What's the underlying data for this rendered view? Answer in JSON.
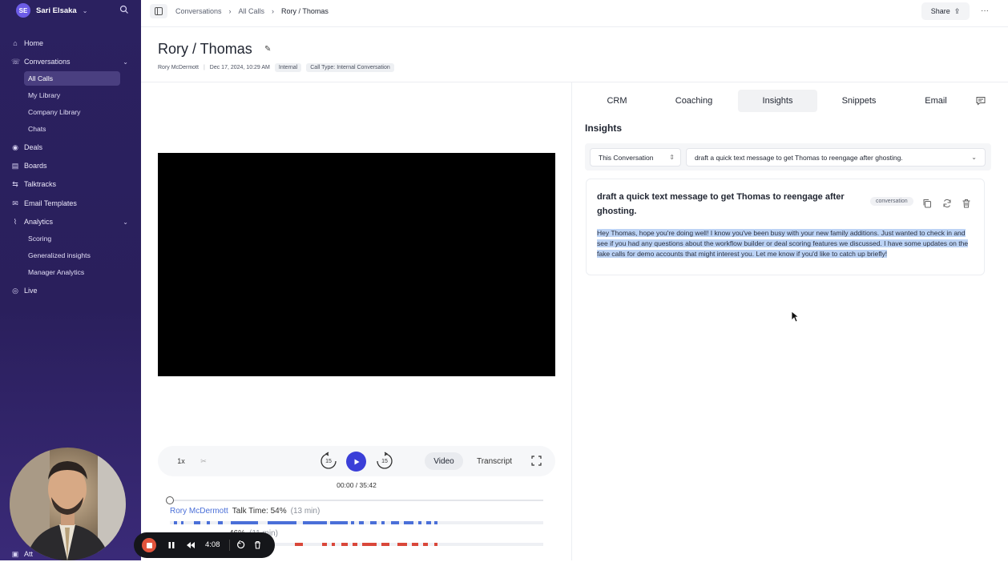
{
  "workspace": {
    "initials": "SE",
    "name": "Sari Elsaka"
  },
  "sidebar": {
    "items": [
      {
        "label": "Home",
        "icon": "home-icon"
      },
      {
        "label": "Conversations",
        "icon": "chat-icon"
      },
      {
        "label": "Deals",
        "icon": "deals-icon"
      },
      {
        "label": "Boards",
        "icon": "boards-icon"
      },
      {
        "label": "Talktracks",
        "icon": "talktracks-icon"
      },
      {
        "label": "Email Templates",
        "icon": "email-icon"
      },
      {
        "label": "Analytics",
        "icon": "analytics-icon"
      },
      {
        "label": "Live",
        "icon": "live-icon"
      }
    ],
    "conversations_sub": [
      "All Calls",
      "My Library",
      "Company Library",
      "Chats"
    ],
    "analytics_sub": [
      "Scoring",
      "Generalized insights",
      "Manager Analytics"
    ],
    "bottom_label": "Att"
  },
  "breadcrumb": [
    "Conversations",
    "All Calls",
    "Rory / Thomas"
  ],
  "header": {
    "share_label": "Share",
    "more_label": "···"
  },
  "call": {
    "title": "Rory / Thomas",
    "owner": "Rory McDermott",
    "date": "Dec 17, 2024, 10:29 AM",
    "tags": [
      "Internal",
      "Call Type: Internal Conversation"
    ]
  },
  "player": {
    "speed": "1x",
    "back_seconds": "15",
    "forward_seconds": "15",
    "view_video": "Video",
    "view_transcript": "Transcript",
    "time": "00:00 / 35:42",
    "progress": 0
  },
  "speakers": [
    {
      "name": "Rory McDermott",
      "talk_time": "Talk Time: 54%",
      "minutes": "(13 min)",
      "color": "#4a6fd8"
    },
    {
      "name": "",
      "talk_time": "46%",
      "minutes": "(11 min)",
      "color": "#d9473a"
    }
  ],
  "recorder": {
    "elapsed": "4:08"
  },
  "tabs": [
    "CRM",
    "Coaching",
    "Insights",
    "Snippets",
    "Email"
  ],
  "active_tab": "Insights",
  "insights": {
    "heading": "Insights",
    "scope": "This Conversation",
    "prompt_value": "draft a quick text message to get Thomas to reengage after ghosting.",
    "card": {
      "question": "draft a quick text message to get Thomas to reengage after ghosting.",
      "badge": "conversation",
      "answer": "Hey Thomas, hope you're doing well! I know you've been busy with your new family additions. Just wanted to check in and see if you had any questions about the workflow builder or deal scoring features we discussed. I have some updates on the fake calls for demo accounts that might interest you. Let me know if you'd like to catch up briefly!"
    }
  },
  "colors": {
    "sidebar": "#2b2160",
    "accent": "#3b3fd8",
    "speaker1": "#4a6fd8",
    "speaker2": "#d9473a",
    "highlight": "#bcd3f5"
  }
}
